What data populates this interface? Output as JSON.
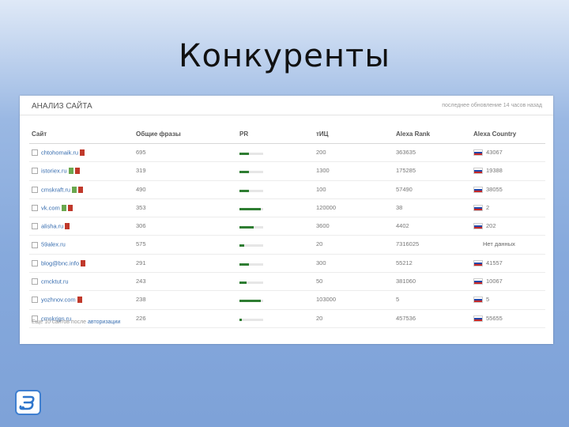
{
  "slide": {
    "title": "Конкуренты"
  },
  "panel": {
    "title": "АНАЛИЗ САЙТА",
    "note": "последнее обновление 14 часов назад",
    "footer_text": "Еще 10 сайтов после",
    "footer_link": "авторизации"
  },
  "table": {
    "headers": [
      "Сайт",
      "Общие фразы",
      "PR",
      "тИЦ",
      "Alexa Rank",
      "Alexa Country"
    ],
    "rows": [
      {
        "site": "chtohomaik.ru",
        "badges": [
          "red"
        ],
        "phrases": "695",
        "pr": 0.4,
        "tic": "200",
        "alexa_rank": "363635",
        "country": "43067",
        "country_flag": true
      },
      {
        "site": "istoriex.ru",
        "badges": [
          "green",
          "red"
        ],
        "phrases": "319",
        "pr": 0.4,
        "tic": "1300",
        "alexa_rank": "175285",
        "country": "19388",
        "country_flag": true
      },
      {
        "site": "cmskraft.ru",
        "badges": [
          "green",
          "red"
        ],
        "phrases": "490",
        "pr": 0.4,
        "tic": "100",
        "alexa_rank": "57490",
        "country": "38055",
        "country_flag": true
      },
      {
        "site": "vk.com",
        "badges": [
          "green",
          "red"
        ],
        "phrases": "353",
        "pr": 0.9,
        "tic": "120000",
        "alexa_rank": "38",
        "country": "2",
        "country_flag": true
      },
      {
        "site": "alisha.ru",
        "badges": [
          "red"
        ],
        "phrases": "306",
        "pr": 0.6,
        "tic": "3600",
        "alexa_rank": "4402",
        "country": "202",
        "country_flag": true
      },
      {
        "site": "59alex.ru",
        "badges": [],
        "phrases": "575",
        "pr": 0.2,
        "tic": "20",
        "alexa_rank": "7316025",
        "country": "Нет данных",
        "country_flag": false
      },
      {
        "site": "blog@bnc.info",
        "badges": [
          "red"
        ],
        "phrases": "291",
        "pr": 0.4,
        "tic": "300",
        "alexa_rank": "55212",
        "country": "41557",
        "country_flag": true
      },
      {
        "site": "cmcktut.ru",
        "badges": [],
        "phrases": "243",
        "pr": 0.3,
        "tic": "50",
        "alexa_rank": "381060",
        "country": "10067",
        "country_flag": true
      },
      {
        "site": "yozhnov.com",
        "badges": [
          "red"
        ],
        "phrases": "238",
        "pr": 0.9,
        "tic": "103000",
        "alexa_rank": "5",
        "country": "5",
        "country_flag": true
      },
      {
        "site": "cmskrjgs.ru",
        "badges": [],
        "phrases": "226",
        "pr": 0.1,
        "tic": "20",
        "alexa_rank": "457536",
        "country": "55655",
        "country_flag": true
      }
    ]
  }
}
